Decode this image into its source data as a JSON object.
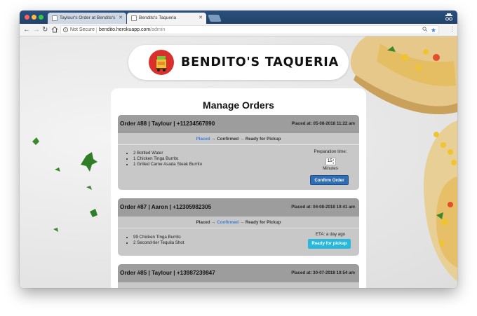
{
  "browser": {
    "tabs": [
      {
        "title": "Taylour's Order at Bendito's Taqueria"
      },
      {
        "title": "Bendito's Taqueria"
      }
    ],
    "address": {
      "security_label": "Not Secure",
      "host": "bendito.herokuapp.com",
      "path": "/admin"
    }
  },
  "brand": {
    "name": "BENDITO'S TAQUERIA"
  },
  "page": {
    "title": "Manage Orders"
  },
  "colors": {
    "brand_red": "#d9302c",
    "status_active": "#3b7bd8",
    "confirm_button": "#2f6db5",
    "pickup_button": "#28b8dc"
  },
  "orders": [
    {
      "title": "Order #88 | Taylour | +11234567890",
      "placed": "Placed at: 05-08-2018 11:22 am",
      "status_steps": [
        "Placed",
        "Confirmed",
        "Ready for Pickup"
      ],
      "status_arrow": "→",
      "active_step": 0,
      "items": [
        "2 Bottled Water",
        "1 Chicken Tinga Burrito",
        "1 Grilled Carne Asada Steak Burrito"
      ],
      "prep_label": "Preparation time:",
      "prep_value": "15",
      "prep_unit": "Minutes",
      "action": "Confirm Order"
    },
    {
      "title": "Order #87 | Aaron | +12305982305",
      "placed": "Placed at: 04-08-2018 10:41 am",
      "status_steps": [
        "Placed",
        "Confirmed",
        "Ready for Pickup"
      ],
      "status_arrow": "→",
      "active_step": 1,
      "items": [
        "99 Chicken Tinga Burrito",
        "2 Second-tier Tequila Shot"
      ],
      "eta": "ETA: a day ago",
      "action": "Ready for pickup"
    },
    {
      "title": "Order #85 | Taylour | +13987239847",
      "placed": "Placed at: 30-07-2018 10:54 am"
    }
  ]
}
